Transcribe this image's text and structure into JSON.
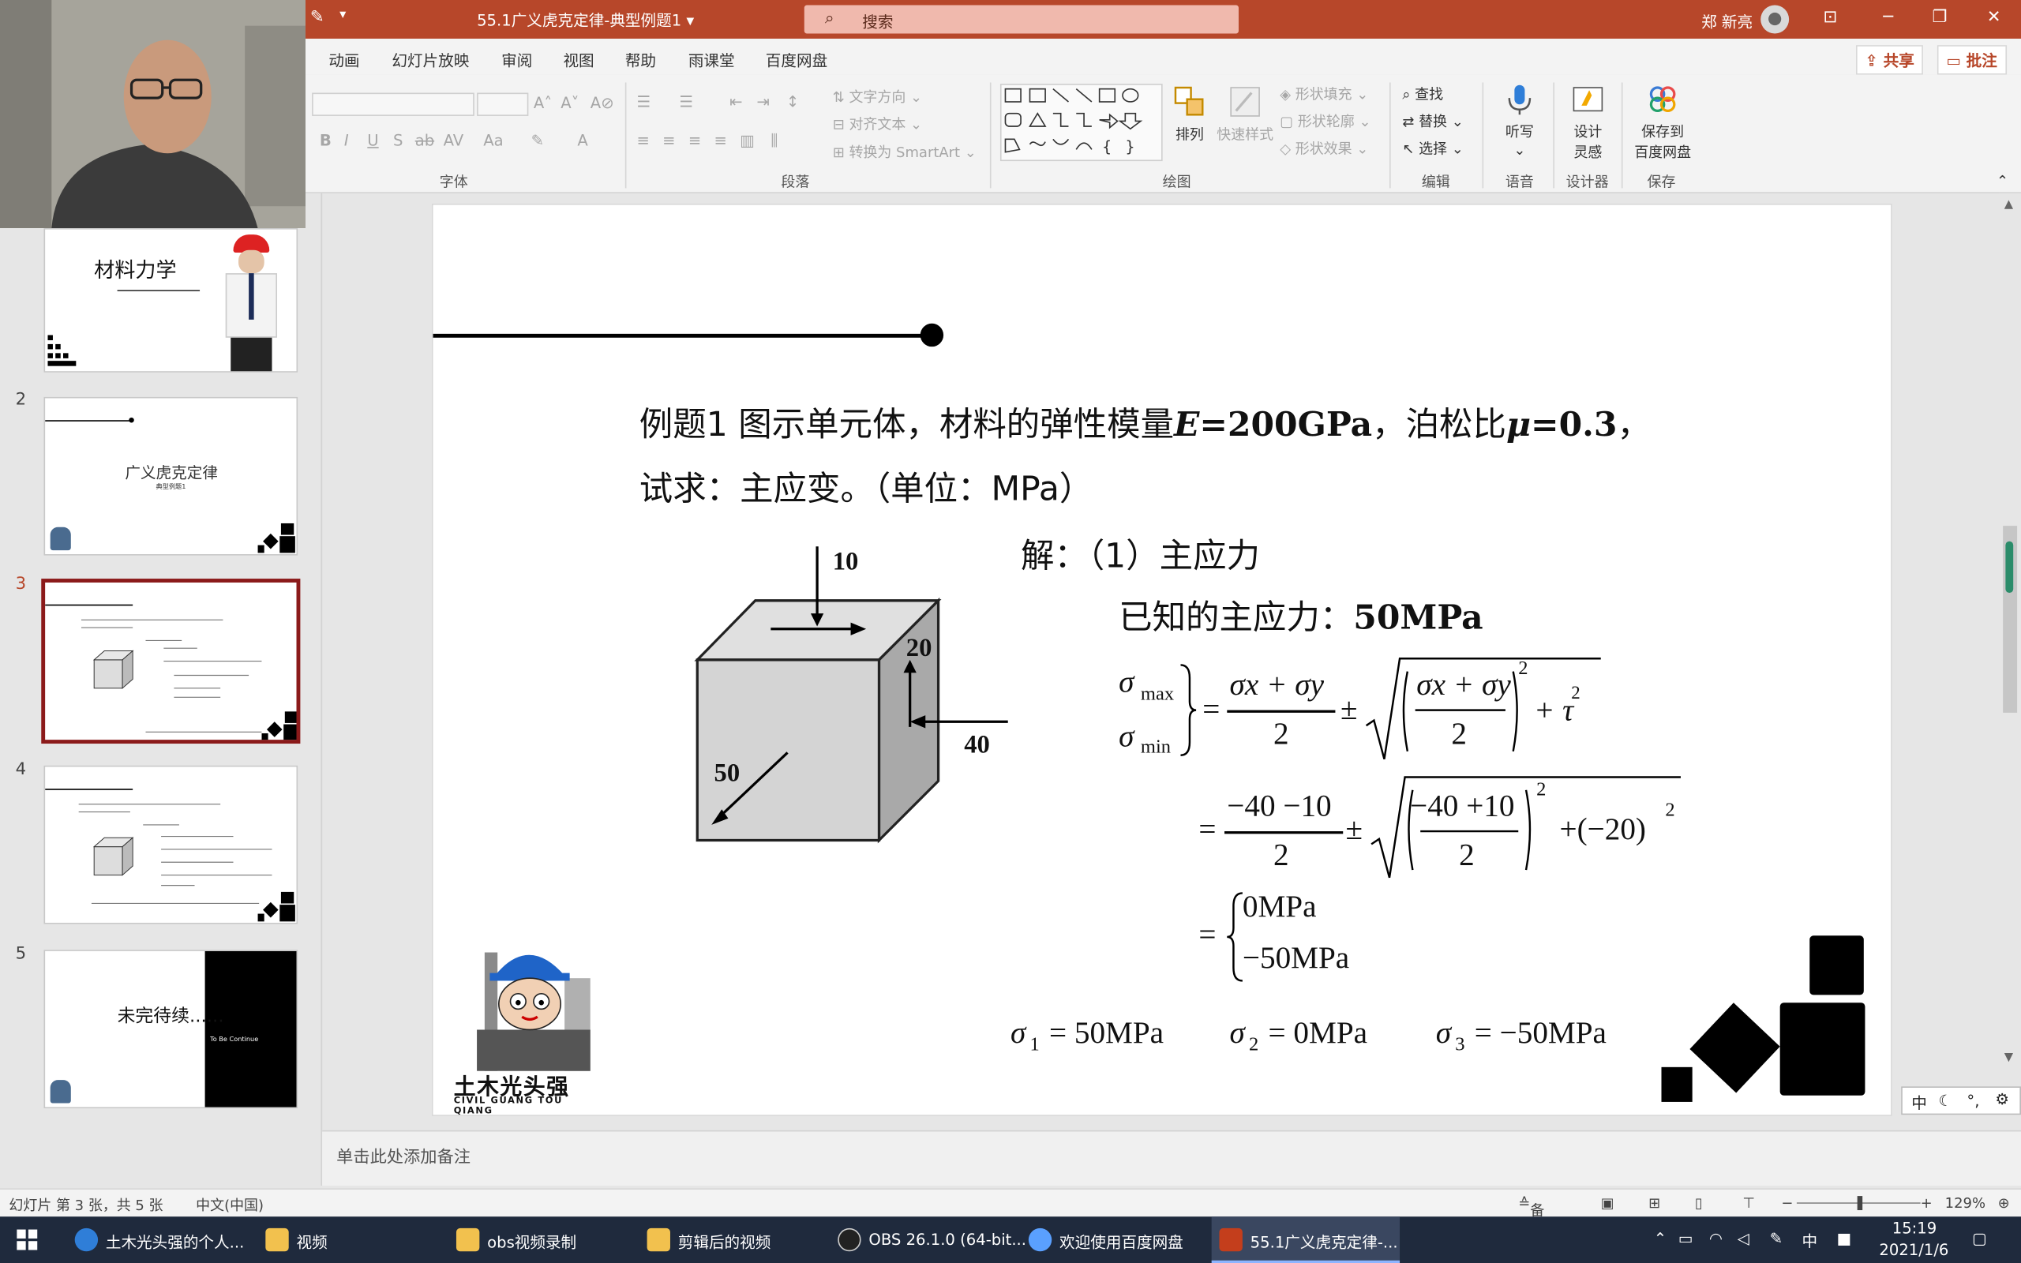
{
  "window": {
    "doc_title": "55.1广义虎克定律-典型例题1",
    "search_placeholder": "搜索",
    "user_name": "郑 新亮",
    "share_label": "共享",
    "comment_label": "批注"
  },
  "ribbon": {
    "tabs": [
      "动画",
      "幻灯片放映",
      "审阅",
      "视图",
      "帮助",
      "雨课堂",
      "百度网盘"
    ],
    "groups": {
      "font": "字体",
      "paragraph": "段落",
      "drawing": "绘图",
      "editing": "编辑",
      "voice": "语音",
      "designer": "设计器",
      "save": "保存"
    },
    "paragraph_items": {
      "text_direction": "文字方向",
      "align_text": "对齐文本",
      "smartart": "转换为 SmartArt"
    },
    "drawing_items": {
      "arrange": "排列",
      "quick_styles": "快速样式",
      "shape_fill": "形状填充",
      "shape_outline": "形状轮廓",
      "shape_effects": "形状效果"
    },
    "editing_items": {
      "find": "查找",
      "replace": "替换",
      "select": "选择"
    },
    "voice_button": "听写",
    "designer_button_line1": "设计",
    "designer_button_line2": "灵感",
    "save_button_line1": "保存到",
    "save_button_line2": "百度网盘"
  },
  "thumbnails": {
    "slide1_title": "材料力学",
    "slide2_num": "2",
    "slide2_title": "广义虎克定律",
    "slide2_sub": "典型例题1",
    "slide3_num": "3",
    "slide4_num": "4",
    "slide5_num": "5",
    "slide5_title": "未完待续......",
    "slide5_sub": "To Be Continue"
  },
  "slide": {
    "problem_prefix": "例题1 图示单元体，材料的弹性模量",
    "E_symbol": "E",
    "E_value": "=200GPa",
    "poisson_text": "，泊松比",
    "mu_symbol": "μ",
    "mu_value": "=0.3",
    "trailing_comma": "，",
    "line2": "试求：主应变。（单位：MPa）",
    "solution_heading": "解：（1）主应力",
    "known_label": "已知的主应力：",
    "known_value": "50MPa",
    "fig_labels": {
      "top": "10",
      "right_vert": "20",
      "right_horiz": "40",
      "diag": "50"
    },
    "formula": {
      "sigma_max": "σ",
      "max_sub": "max",
      "min_sub": "min",
      "step1_num": "σx + σy",
      "step1_den": "2",
      "pm": "±",
      "step2_num": "−40 −10",
      "step2_inner_num": "−40 +10",
      "step2_tail": "+(−20)",
      "exp": "2",
      "result_a": "0MPa",
      "result_b": "−50MPa"
    },
    "principal": {
      "s1": "= 50MPa",
      "s2": "= 0MPa",
      "s3": "= −50MPa",
      "sub1": "1",
      "sub2": "2",
      "sub3": "3",
      "sigma": "σ"
    },
    "logo_text": "土木光头强",
    "logo_sub": "CIVIL GUANG TOU QIANG"
  },
  "notes_placeholder": "单击此处添加备注",
  "status": {
    "slide_info": "幻灯片 第 3 张，共 5 张",
    "language": "中文(中国)",
    "notes_btn": "备注",
    "zoom": "129%"
  },
  "taskbar": {
    "items": [
      "土木光头强的个人...",
      "视频",
      "obs视频录制",
      "剪辑后的视频",
      "OBS 26.1.0 (64-bit...",
      "欢迎使用百度网盘",
      "55.1广义虎克定律-..."
    ],
    "time": "15:19",
    "date": "2021/1/6",
    "ime": "中"
  },
  "colors": {
    "accent": "#b7472a",
    "selected_border": "#8b1a1a",
    "taskbar": "#1f2a3d"
  }
}
